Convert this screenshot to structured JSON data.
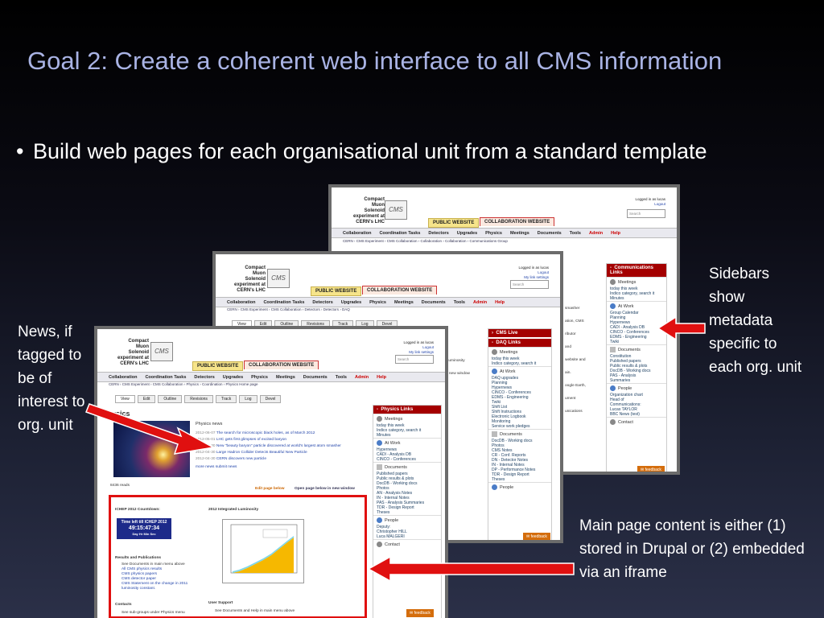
{
  "slide": {
    "title": "Goal 2:  Create a coherent web interface to all CMS information",
    "bullet_symbol": "•",
    "bullet_text": "Build web pages for each organisational unit from a standard template"
  },
  "annotations": {
    "news": "News, if tagged to be of interest to org. unit",
    "sidebars": "Sidebars show metadata specific to each org. unit",
    "main_content": "Main page content is either (1) stored in Drupal or (2) embedded via an iframe"
  },
  "site_template": {
    "logo_lines": [
      "Compact",
      "Muon",
      "Solenoid",
      "experiment at",
      "CERN's LHC"
    ],
    "logo_mark": "CMS",
    "public_tab": "PUBLIC WEBSITE",
    "collab_tab": "COLLABORATION WEBSITE",
    "nav": [
      "Collaboration",
      "Coordination Tasks",
      "Detectors",
      "Upgrades",
      "Physics",
      "Meetings",
      "Documents",
      "Tools",
      "Admin",
      "Help"
    ],
    "login_text": "Logged in as lucas",
    "logout": "Logout",
    "my_link_settings": "My link settings",
    "search_placeholder": "Search",
    "view_tabs": [
      "View",
      "Edit",
      "Outline",
      "Revisions",
      "Track",
      "Log",
      "Devel"
    ],
    "feedback": "feedback"
  },
  "back_shot": {
    "breadcrumb": "CERN › CMS Experiment › CMS Collaboration › Collaboration › Collaboration › Communications Group",
    "sidebar_title": "Communications Links",
    "meetings": "Meetings",
    "meetings_items": [
      "today  this week",
      "Indico category, search it",
      "Minutes"
    ],
    "at_work": "At Work",
    "at_work_items": [
      "Group Calendar",
      "Planning",
      "Hypernews",
      "CADI - Analysis DB",
      "CINCO - Conferences",
      "EDMS - Engineering",
      "Twiki"
    ],
    "documents": "Documents",
    "documents_items": [
      "Constitution",
      "Published papers",
      "Public results & plots",
      "DocDB - Working docs",
      "PAS - Analysis",
      "Summaries"
    ],
    "people": "People",
    "people_items": [
      "Organization chart",
      "Head of",
      "Communications:",
      "Lucas TAYLOR",
      "BBC News (test)"
    ],
    "contact": "Contact",
    "fragments": [
      "smasher",
      "ation, CMS",
      "ributor",
      "and",
      "website and",
      "ain.",
      "oogle Earth,",
      "ument",
      "unications"
    ]
  },
  "mid_shot": {
    "breadcrumb": "CERN › CMS Experiment › CMS Collaboration › Detectors › Detectors › DAQ",
    "cms_live": "CMS Live",
    "sidebar_title": "DAQ Links",
    "meetings": "Meetings",
    "meetings_items": [
      "today  this week",
      "Indico category, search it"
    ],
    "at_work": "At Work",
    "at_work_items": [
      "DAQ upgrades",
      "Planning",
      "Hypernews",
      "CINCO - Conferences",
      "EDMS - Engineering",
      "Twiki",
      "Shift List",
      "Shift Instructions",
      "Electronic Logbook",
      "Monitoring",
      "Service work pledges"
    ],
    "documents": "Documents",
    "documents_items": [
      "DocDB - Working docs",
      "Photos",
      "CMS Notes",
      "CR - Conf. Reports",
      "DN - Detector Notes",
      "IN - Internal Notes",
      "DP - Performance Notes",
      "TDR - Design Report",
      "Theses"
    ],
    "people": "People",
    "fragments": [
      "gh Luminosity",
      "w in new window"
    ]
  },
  "front_shot": {
    "breadcrumb": "CERN › CMS Experiment › CMS Collaboration › Physics › Coordination › Physics Home page",
    "page_heading": "ysics",
    "physics_news": "Physics news",
    "news": [
      {
        "date": "2012-06-07",
        "text": "The search for microscopic black holes, as of March 2012"
      },
      {
        "date": "2012-05-01",
        "text": "LHC gets first glimpses of excited baryon"
      },
      {
        "date": "2012-04-30",
        "text": "New \"beauty baryon\" particle discovered at world's largest atom smasher"
      },
      {
        "date": "2012-04-30",
        "text": "Large Hadron Collider Detects Beautiful New Particle"
      },
      {
        "date": "2012-04-30",
        "text": "CERN discovers new particle"
      }
    ],
    "more_news": "more news   submit news",
    "reads": "8436 reads",
    "edit_page_below": "Edit page below",
    "open_new_window": "Open page below in new window",
    "countdown_title": "ICHEP 2012 Countdown:",
    "countdown_line1": "Time left till ICHEP 2012",
    "countdown_time": "49:15:47:34",
    "countdown_units": "Day    Hr    Min   Sec",
    "lumi_title": "2012 Integrated Luminosity",
    "results_heading": "Results and Publications",
    "results_items": [
      "See Documents in main menu above",
      "All CMS physics results",
      "CMS physics papers",
      "CMS detector paper",
      "CMS Statement on the change in 2011 luminosity constant."
    ],
    "contacts": "Contacts",
    "contacts_item": "See sub-groups under Physics menu",
    "user_support": "User Support",
    "user_support_item": "See Documents and Help in main menu above",
    "sidebar_title": "Physics Links",
    "meetings": "Meetings",
    "meetings_items": [
      "today  this week",
      "Indico category, search it",
      "Minutes"
    ],
    "at_work": "At Work",
    "at_work_items": [
      "Hypernews",
      "CADI - Analysis DB",
      "CINCO - Conferences"
    ],
    "documents": "Documents",
    "documents_items": [
      "Published papers",
      "Public results & plots",
      "DocDB - Working docs",
      "Photos",
      "AN - Analysis Notes",
      "IN - Internal Notes",
      "PAS - Analysis Summaries",
      "TDR - Design Report",
      "Theses"
    ],
    "people": "People",
    "people_items": [
      "Deputy:",
      "Christopher HILL",
      "Luca MALGERI"
    ],
    "contact": "Contact"
  },
  "colors": {
    "accent_title": "#a9b3e4",
    "highlight_red": "#e01010",
    "sidebar_red": "#a40000",
    "feedback_orange": "#d46d0c"
  }
}
